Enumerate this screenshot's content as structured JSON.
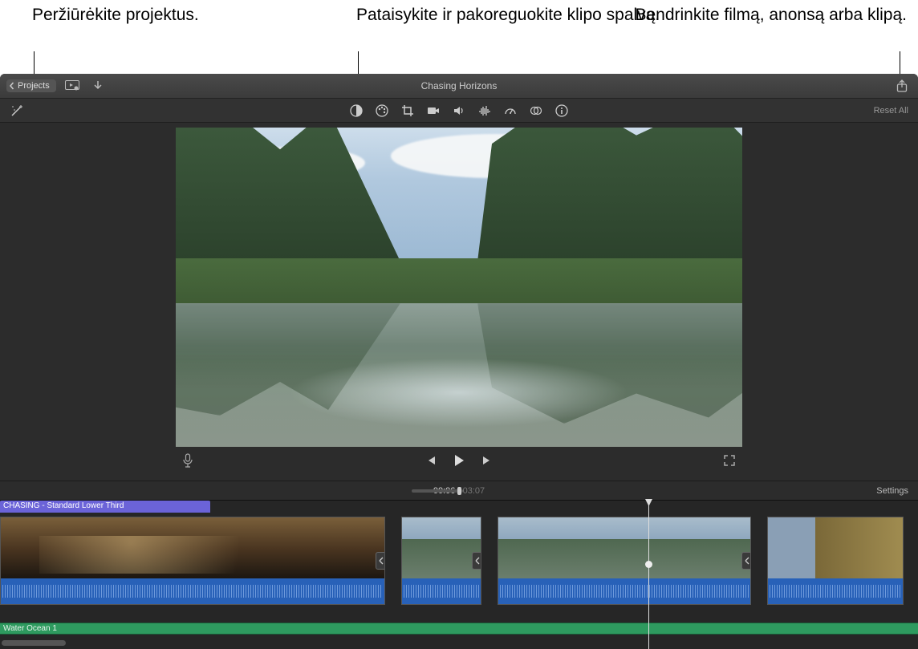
{
  "callouts": {
    "projects": "Peržiūrėkite projektus.",
    "color": "Pataisykite ir pakoreguokite klipo spalvą.",
    "share": "Bendrinkite filmą, anonsą arba klipą."
  },
  "titlebar": {
    "projects_label": "Projects",
    "project_title": "Chasing Horizons"
  },
  "toolbar": {
    "reset_label": "Reset All"
  },
  "timebar": {
    "current": "00:06",
    "sep": " / ",
    "duration": "03:07",
    "settings_label": "Settings"
  },
  "timeline": {
    "title_clip": "CHASING - Standard Lower Third",
    "audio_clip": "Water Ocean 1"
  }
}
